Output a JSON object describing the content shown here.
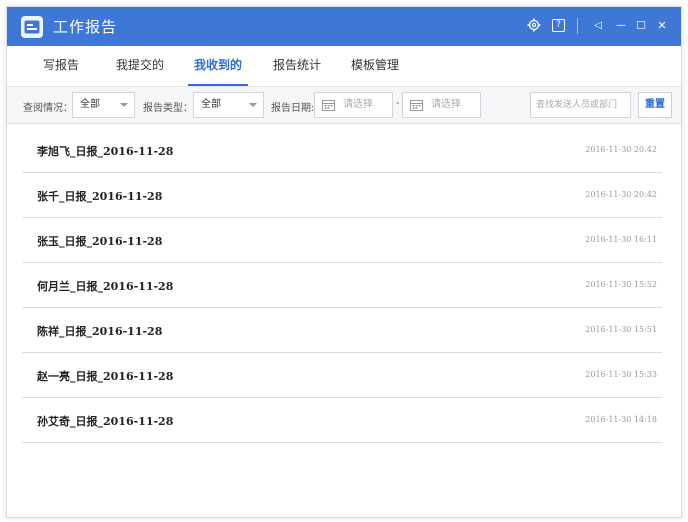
{
  "window": {
    "title": "工作报告",
    "controls": {
      "settings_icon": "gear-icon",
      "help_icon": "help-icon",
      "pin_icon": "pin-icon",
      "minimize_icon": "minimize-icon",
      "maximize_icon": "maximize-icon",
      "close_icon": "close-icon",
      "minimize_glyph": "—",
      "maximize_glyph": "☐",
      "close_glyph": "✕",
      "help_glyph": "?",
      "pin_glyph": "◁"
    }
  },
  "tabs": [
    {
      "label": "写报告"
    },
    {
      "label": "我提交的"
    },
    {
      "label": "我收到的"
    },
    {
      "label": "报告统计"
    },
    {
      "label": "模板管理"
    }
  ],
  "active_tab": "我收到的",
  "filters": {
    "read_status_label": "查阅情况：",
    "read_status_value": "全部",
    "report_type_label": "报告类型：",
    "report_type_value": "全部",
    "date_label": "报告日期:",
    "date_start_placeholder": "请选择",
    "date_separator": "-",
    "date_end_placeholder": "请选择",
    "search_placeholder": "查找发送人员或部门",
    "reset_label": "重置"
  },
  "reports": [
    {
      "name": "李旭飞_日报_2016-11-28",
      "time": "2016-11-30 20:42"
    },
    {
      "name": "张千_日报_2016-11-28",
      "time": "2016-11-30 20:42"
    },
    {
      "name": "张玉_日报_2016-11-28",
      "time": "2016-11-30 16:11"
    },
    {
      "name": "何月兰_日报_2016-11-28",
      "time": "2016-11-30 15:52"
    },
    {
      "name": "陈祥_日报_2016-11-28",
      "time": "2016-11-30 15:51"
    },
    {
      "name": "赵一亮_日报_2016-11-28",
      "time": "2016-11-30 15:33"
    },
    {
      "name": "孙艾奇_日报_2016-11-28",
      "time": "2016-11-30 14:18"
    }
  ],
  "colors": {
    "titlebar": "#3f77d6",
    "accent": "#2f6fd8"
  }
}
